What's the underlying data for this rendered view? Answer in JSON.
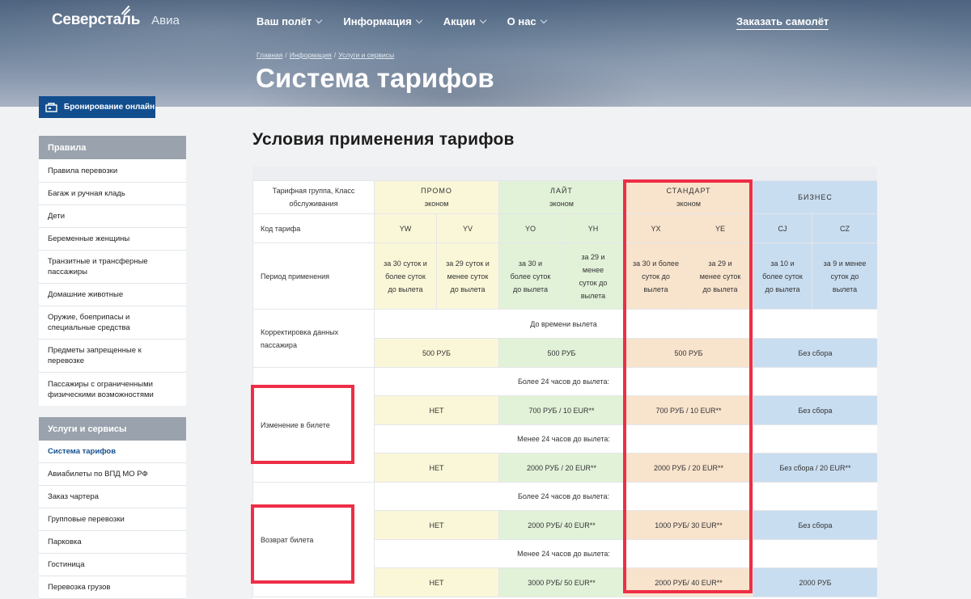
{
  "header": {
    "logo_main": "Северсталь",
    "logo_sub": "Авиа",
    "nav": [
      {
        "label": "Ваш полёт"
      },
      {
        "label": "Информация"
      },
      {
        "label": "Акции"
      },
      {
        "label": "О нас"
      }
    ],
    "order_plane": "Заказать самолёт",
    "breadcrumb": [
      "Главная",
      "Информация",
      "Услуги и сервисы"
    ],
    "page_title": "Система тарифов"
  },
  "sidebar": {
    "booking_button": "Бронирование онлайн",
    "rules_title": "Правила",
    "rules_items": [
      "Правила перевозки",
      "Багаж и ручная кладь",
      "Дети",
      "Беременные женщины",
      "Транзитные и трансферные пассажиры",
      "Домашние животные",
      "Оружие, боеприпасы и специальные средства",
      "Предметы запрещенные к перевозке",
      "Пассажиры с ограниченными физическими возможностями"
    ],
    "services_title": "Услуги и сервисы",
    "services_items": [
      "Система тарифов",
      "Авиабилеты по ВПД МО РФ",
      "Заказ чартера",
      "Групповые перевозки",
      "Парковка",
      "Гостиница",
      "Перевозка грузов"
    ],
    "active_item": "Система тарифов"
  },
  "main": {
    "section_title": "Условия применения тарифов",
    "table": {
      "group_header_label": "Тарифная группа, Класс обслуживания",
      "groups": [
        {
          "name": "ПРОМО",
          "sub": "эконом"
        },
        {
          "name": "ЛАЙТ",
          "sub": "эконом"
        },
        {
          "name": "СТАНДАРТ",
          "sub": "эконом"
        },
        {
          "name": "БИЗНЕС",
          "sub": ""
        }
      ],
      "code_label": "Код тарифа",
      "codes": [
        "YW",
        "YV",
        "YO",
        "YH",
        "YX",
        "YE",
        "CJ",
        "CZ"
      ],
      "period_label": "Период применения",
      "periods": [
        "за 30 суток и более суток до вылета",
        "за 29 суток и менее суток до вылета",
        "за 30 и более суток до вылета",
        "за 29 и менее суток до вылета",
        "за 30 и более суток до вылета",
        "за 29 и менее суток до вылета",
        "за 10 и более суток до вылета",
        "за 9 и менее суток до вылета"
      ],
      "correction_label": "Корректировка данных пассажира",
      "correction_note": "До времени вылета",
      "correction_values": [
        "500 РУБ",
        "500 РУБ",
        "500 РУБ",
        "Без сбора"
      ],
      "change_label": "Изменение в билете",
      "change_more_note": "Более 24 часов до вылета:",
      "change_more_values": [
        "НЕТ",
        "700 РУБ / 10 EUR**",
        "700 РУБ / 10 EUR**",
        "Без сбора"
      ],
      "change_less_note": "Менее 24 часов до вылета:",
      "change_less_values": [
        "НЕТ",
        "2000 РУБ / 20 EUR**",
        "2000 РУБ / 20 EUR**",
        "Без сбора / 20 EUR**"
      ],
      "refund_label": "Возврат билета",
      "refund_more_note": "Более 24 часов до вылета:",
      "refund_more_values": [
        "НЕТ",
        "2000 РУБ/ 40 EUR**",
        "1000 РУБ/ 30 EUR**",
        "Без сбора"
      ],
      "refund_less_note": "Менее 24 часов до вылета:",
      "refund_less_values": [
        "НЕТ",
        "3000 РУБ/ 50 EUR**",
        "2000 РУБ/ 40 EUR**",
        "2000 РУБ"
      ]
    }
  },
  "colors": {
    "promo": "#faf7d8",
    "lite": "#e2f2d9",
    "standard": "#f8e3cd",
    "business": "#c9ddf0",
    "accent_blue": "#124e8e",
    "highlight_red": "#ef2d46"
  }
}
